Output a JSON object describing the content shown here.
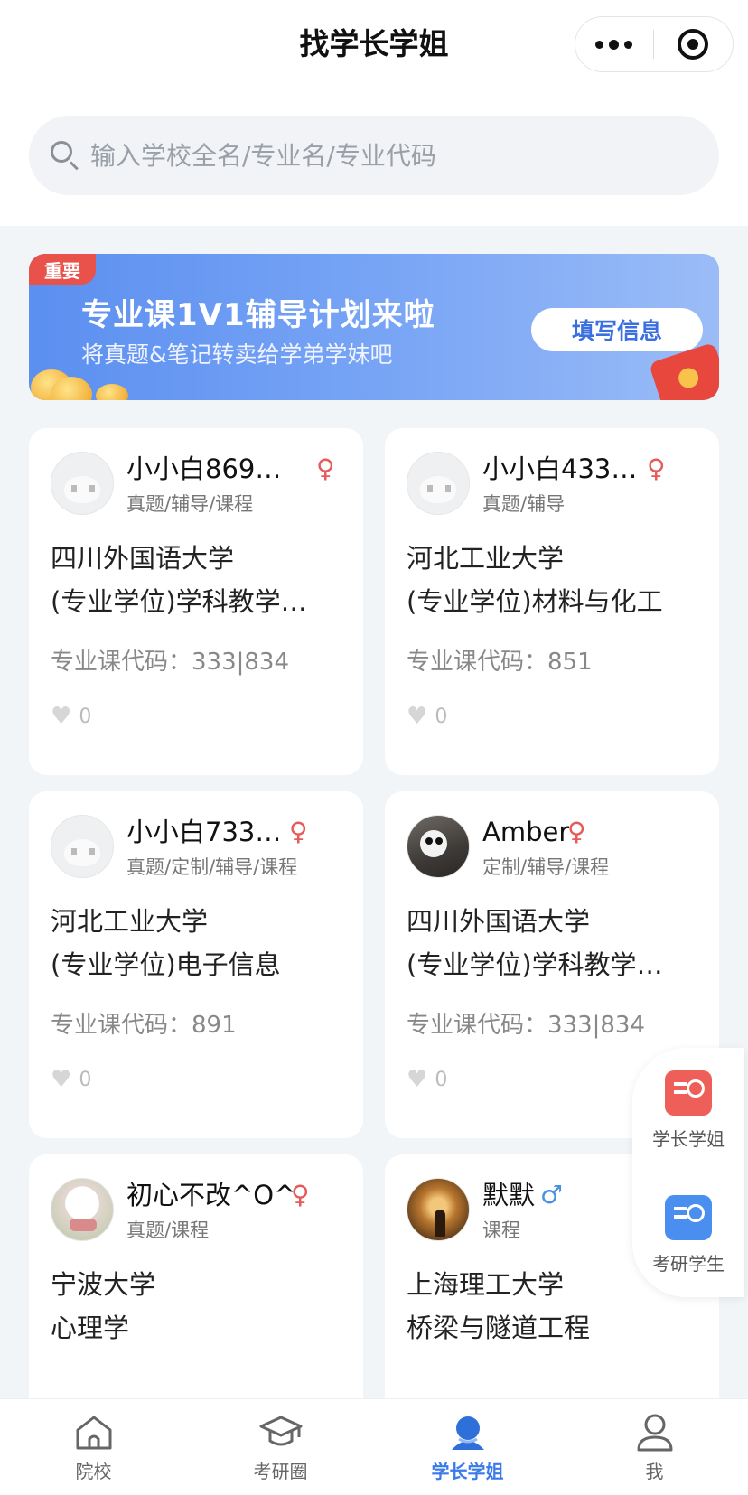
{
  "header": {
    "title": "找学长学姐"
  },
  "search": {
    "placeholder": "输入学校全名/专业名/专业代码"
  },
  "banner": {
    "tag": "重要",
    "headline": "专业课1V1辅导计划来啦",
    "subtitle": "将真题&笔记转卖给学弟学妹吧",
    "button_label": "填写信息"
  },
  "cards": [
    {
      "name": "小小白869…",
      "gender": "♀",
      "services": "真题/辅导/课程",
      "school": "四川外国语大学",
      "major": "(专业学位)学科教学…",
      "code": "专业课代码：333|834",
      "likes": "0"
    },
    {
      "name": "小小白433…",
      "gender": "♀",
      "services": "真题/辅导",
      "school": "河北工业大学",
      "major": "(专业学位)材料与化工",
      "code": "专业课代码：851",
      "likes": "0"
    },
    {
      "name": "小小白733…",
      "gender": "♀",
      "services": "真题/定制/辅导/课程",
      "school": "河北工业大学",
      "major": "(专业学位)电子信息",
      "code": "专业课代码：891",
      "likes": "0"
    },
    {
      "name": "Amber",
      "gender": "♀",
      "services": "定制/辅导/课程",
      "school": "四川外国语大学",
      "major": "(专业学位)学科教学…",
      "code": "专业课代码：333|834",
      "likes": "0"
    },
    {
      "name": "初心不改^O^",
      "gender": "♀",
      "services": "真题/课程",
      "school": "宁波大学",
      "major": "心理学",
      "code": "",
      "likes": ""
    },
    {
      "name": "默默",
      "gender": "♂",
      "services": "课程",
      "school": "上海理工大学",
      "major": "桥梁与隧道工程",
      "code": "",
      "likes": ""
    }
  ],
  "float_panel": {
    "items": [
      {
        "label": "学长学姐",
        "icon": "senior-profile-icon",
        "color": "#ef5f5a"
      },
      {
        "label": "考研学生",
        "icon": "student-profile-icon",
        "color": "#4a8ff0"
      }
    ]
  },
  "tabbar": {
    "items": [
      {
        "label": "院校",
        "icon": "school-icon"
      },
      {
        "label": "考研圈",
        "icon": "graduation-cap-icon"
      },
      {
        "label": "学长学姐",
        "icon": "senior-icon",
        "active": true
      },
      {
        "label": "我",
        "icon": "person-icon"
      }
    ]
  },
  "colors": {
    "accent": "#3a7bea",
    "female": "#e75a5a",
    "male": "#4a90e2",
    "tag_red": "#e9524b"
  }
}
